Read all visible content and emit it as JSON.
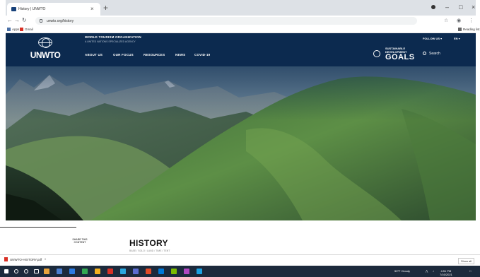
{
  "browser": {
    "tab_title": "History | UNWTO",
    "tab_close": "×",
    "new_tab": "+",
    "url": "unwto.org/history",
    "window_controls": [
      "–",
      "□",
      "×"
    ],
    "bookmarks": [
      "Apps",
      "Gmail"
    ],
    "bookmarks_right": "Reading list"
  },
  "site": {
    "logo_text": "UNWTO",
    "org_name": "WORLD TOURISM ORGANIZATION",
    "org_sub": "A UNITED NATIONS SPECIALIZED AGENCY",
    "follow_us": "FOLLOW US",
    "language": "EN",
    "nav": [
      "ABOUT US",
      "OUR FOCUS",
      "RESOURCES",
      "NEWS",
      "COVID-19"
    ],
    "sdg_line1": "SUSTAINABLE",
    "sdg_line2": "DEVELOPMENT",
    "sdg_goals": "GOALS",
    "search_label": "Search"
  },
  "page": {
    "share_label": "SHARE THIS CONTENT",
    "heading": "HISTORY",
    "breadcrumb": "BASE / SOLO / LAND / TIME / TENT"
  },
  "downloads": {
    "file": "UNWTO-HISTORY.pdf",
    "chevron": "^",
    "show_all": "Show all"
  },
  "taskbar": {
    "weather": "59°F Cloudy",
    "time": "4:51 PM",
    "date": "7/16/2021",
    "icon_colors": [
      "#e8a33d",
      "#4b7fd1",
      "#2a7ae2",
      "#33a852",
      "#f2b01e",
      "#d93025",
      "#2aa8e0",
      "#5b6bd1",
      "#e34a26",
      "#0078d7",
      "#7cbb00",
      "#b146c2",
      "#1ba1e2"
    ]
  }
}
